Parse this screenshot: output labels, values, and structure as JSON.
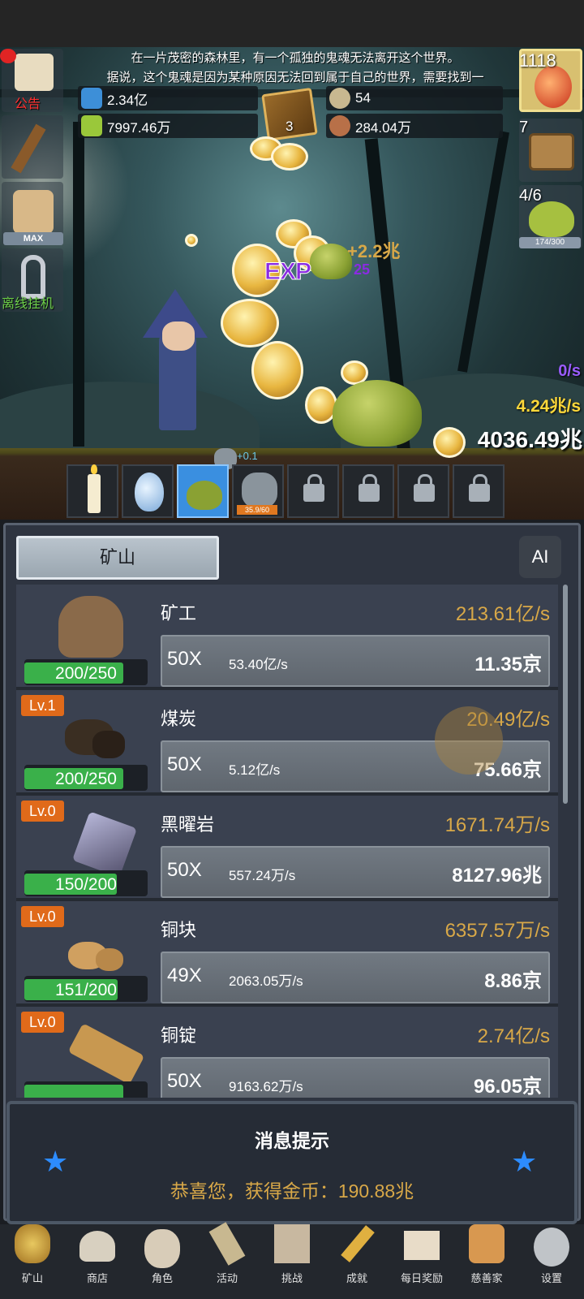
{
  "story": {
    "line1": "在一片茂密的森林里，有一个孤独的鬼魂无法离开这个世界。",
    "line2": "据说，这个鬼魂是因为某种原因无法回到属于自己的世界，需要找到一"
  },
  "resources": {
    "blue_potion": "2.34亿",
    "green_potion": "7997.46万",
    "coin": "54",
    "meat": "284.04万",
    "book_count": "3"
  },
  "left_buttons": {
    "notice_label": "公告",
    "max_label": "MAX",
    "offline_label": "离线挂机"
  },
  "right_buttons": {
    "potion_count": "1118",
    "chest_count": "7",
    "slime_count": "4/6",
    "slime_progress_label": "174/300",
    "slime_progress_fraction": 0.58
  },
  "battle": {
    "exp_label": "EXP",
    "float_gold": "+2.2兆",
    "float_exp": "25",
    "rate_exp": "0/s",
    "rate_gold": "4.24兆/s",
    "total_gold": "4036.49兆",
    "small_float": "+0.1"
  },
  "slots": {
    "ghost_progress": "35.9/60"
  },
  "panel": {
    "tab_label": "矿山",
    "ai_label": "AI"
  },
  "items": [
    {
      "name": "矿工",
      "level": "",
      "hp": "200/250",
      "hp_fraction": 0.8,
      "rate": "213.61亿/s",
      "mult": "50X",
      "each": "53.40亿/s",
      "cost": "11.35京"
    },
    {
      "name": "煤炭",
      "level": "Lv.1",
      "hp": "200/250",
      "hp_fraction": 0.8,
      "rate": "20.49亿/s",
      "mult": "50X",
      "each": "5.12亿/s",
      "cost": "75.66京"
    },
    {
      "name": "黑曜岩",
      "level": "Lv.0",
      "hp": "150/200",
      "hp_fraction": 0.75,
      "rate": "1671.74万/s",
      "mult": "50X",
      "each": "557.24万/s",
      "cost": "8127.96兆"
    },
    {
      "name": "铜块",
      "level": "Lv.0",
      "hp": "151/200",
      "hp_fraction": 0.755,
      "rate": "6357.57万/s",
      "mult": "49X",
      "each": "2063.05万/s",
      "cost": "8.86京"
    },
    {
      "name": "铜锭",
      "level": "Lv.0",
      "hp": "",
      "hp_fraction": 0.8,
      "rate": "2.74亿/s",
      "mult": "50X",
      "each": "9163.62万/s",
      "cost": "96.05京"
    }
  ],
  "message": {
    "title": "消息提示",
    "text": "恭喜您，获得金币：190.88兆"
  },
  "nav": [
    "矿山",
    "商店",
    "角色",
    "活动",
    "挑战",
    "成就",
    "每日奖励",
    "慈善家",
    "设置"
  ],
  "colors": {
    "gold_text": "#d8a848",
    "level_badge": "#e06a1a",
    "hp_fill": "#3ab04a",
    "rate_gold": "#ffd83a",
    "rate_exp": "#9a5cff"
  }
}
